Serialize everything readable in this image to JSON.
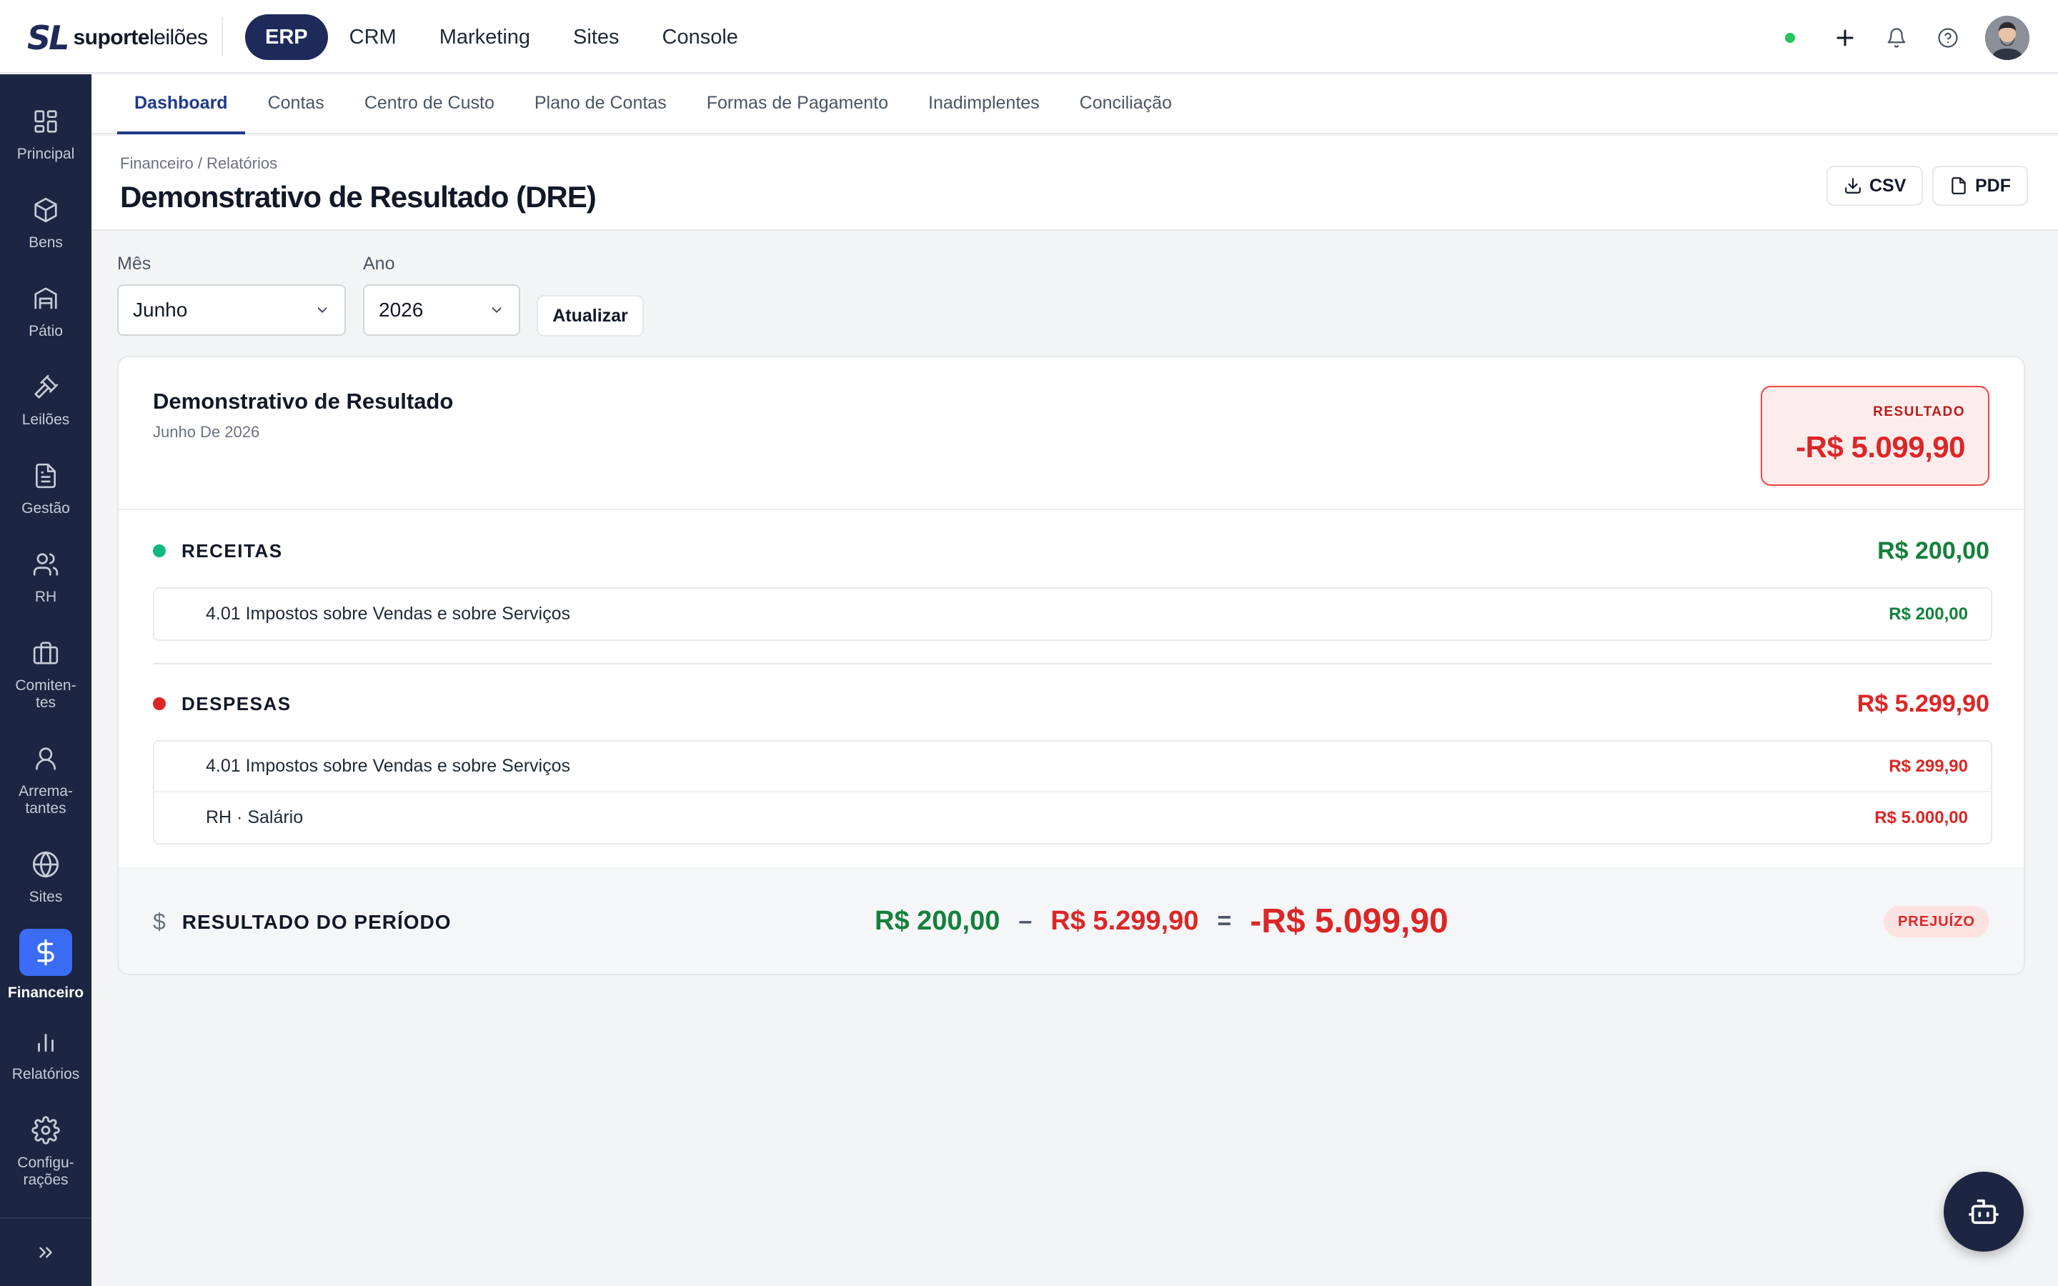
{
  "brand": {
    "logo_mark": "SL",
    "logo_bold": "suporte",
    "logo_light": "leilões"
  },
  "topnav": [
    "ERP",
    "CRM",
    "Marketing",
    "Sites",
    "Console"
  ],
  "sidebar": {
    "items": [
      {
        "label": "Principal",
        "icon": "grid-icon"
      },
      {
        "label": "Bens",
        "icon": "box-icon"
      },
      {
        "label": "Pátio",
        "icon": "warehouse-icon"
      },
      {
        "label": "Leilões",
        "icon": "gavel-icon"
      },
      {
        "label": "Gestão",
        "icon": "document-icon"
      },
      {
        "label": "RH",
        "icon": "users-icon"
      },
      {
        "label": "Comiten-\ntes",
        "icon": "briefcase-icon"
      },
      {
        "label": "Arrema-\ntantes",
        "icon": "user-icon"
      },
      {
        "label": "Sites",
        "icon": "globe-icon"
      },
      {
        "label": "Financeiro",
        "icon": "dollar-icon"
      },
      {
        "label": "Relatórios",
        "icon": "bar-chart-icon"
      },
      {
        "label": "Configu-\nrações",
        "icon": "gear-icon"
      }
    ]
  },
  "subnav": [
    "Dashboard",
    "Contas",
    "Centro de Custo",
    "Plano de Contas",
    "Formas de Pagamento",
    "Inadimplentes",
    "Conciliação"
  ],
  "header": {
    "breadcrumb": "Financeiro / Relatórios",
    "title": "Demonstrativo de Resultado (DRE)",
    "csv_label": "CSV",
    "pdf_label": "PDF"
  },
  "filters": {
    "month_label": "Mês",
    "month_value": "Junho",
    "year_label": "Ano",
    "year_value": "2026",
    "update_label": "Atualizar"
  },
  "report": {
    "title": "Demonstrativo de Resultado",
    "subtitle": "Junho De 2026",
    "result_label": "RESULTADO",
    "result_value": "-R$ 5.099,90",
    "receitas": {
      "name": "RECEITAS",
      "total": "R$ 200,00",
      "rows": [
        {
          "name": "4.01 Impostos sobre Vendas e sobre Serviços",
          "value": "R$ 200,00"
        }
      ]
    },
    "despesas": {
      "name": "DESPESAS",
      "total": "R$ 5.299,90",
      "rows": [
        {
          "name": "4.01 Impostos sobre Vendas e sobre Serviços",
          "value": "R$ 299,90"
        },
        {
          "name": "RH · Salário",
          "value": "R$ 5.000,00"
        }
      ]
    },
    "footer": {
      "dollar": "$",
      "label": "RESULTADO DO PERÍODO",
      "receitas": "R$ 200,00",
      "minus": "–",
      "despesas": "R$ 5.299,90",
      "equals": "=",
      "resultado": "-R$ 5.099,90",
      "badge": "PREJUÍZO"
    }
  },
  "colors": {
    "nav_dark": "#1c2541",
    "accent_blue": "#3b6cf6",
    "positive": "#15803d",
    "negative": "#dc2626",
    "status_online": "#22c55e"
  }
}
